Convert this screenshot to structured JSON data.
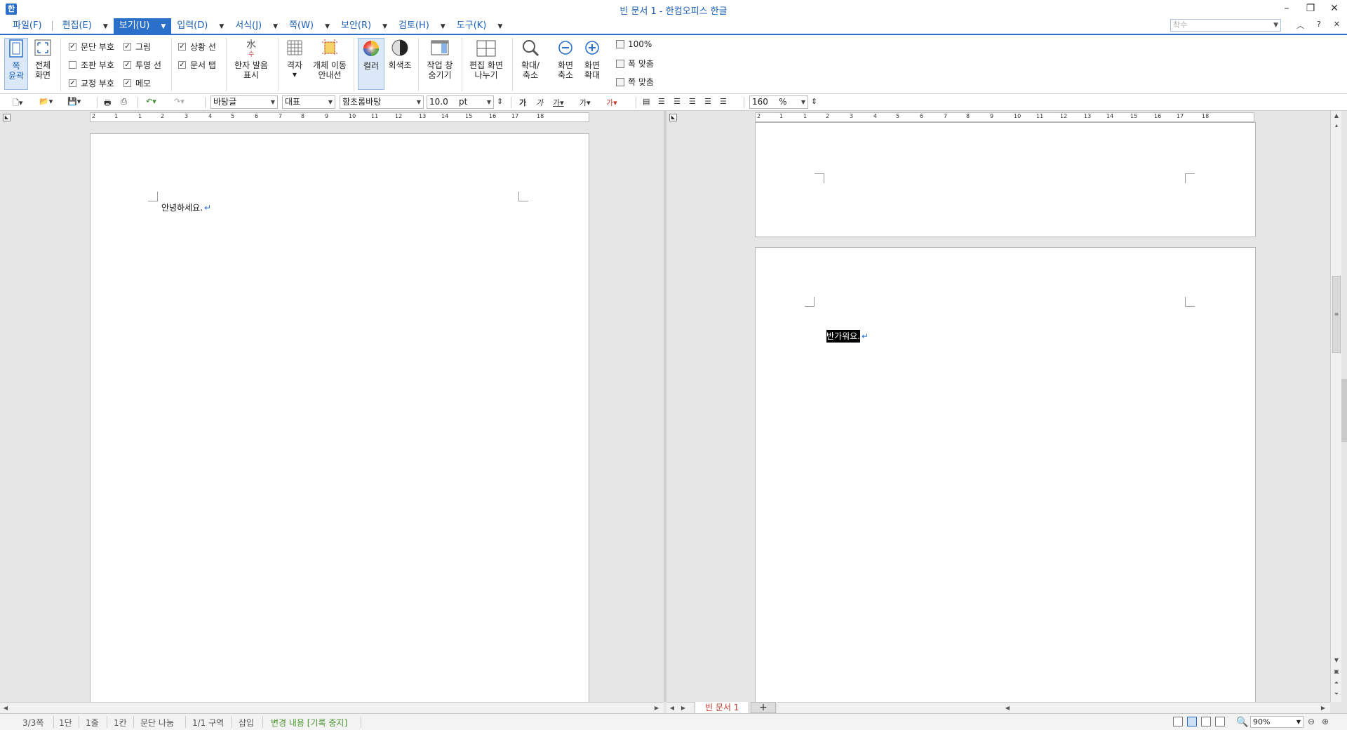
{
  "window": {
    "title": "빈 문서 1 - 한컴오피스 한글",
    "minimize_icon": "minimize-icon",
    "restore_icon": "restore-icon",
    "close_icon": "close-icon"
  },
  "menu": {
    "items": [
      {
        "label": "파일(F)"
      },
      {
        "label": "편집(E)"
      },
      {
        "label": "보기(U)"
      },
      {
        "label": "입력(D)"
      },
      {
        "label": "서식(J)"
      },
      {
        "label": "쪽(W)"
      },
      {
        "label": "보안(R)"
      },
      {
        "label": "검토(H)"
      },
      {
        "label": "도구(K)"
      }
    ],
    "active": "보기(U)",
    "help_search_placeholder": "착수"
  },
  "ribbon": {
    "page_outline": "쪽\n윤곽",
    "full_screen": "전체\n화면",
    "checkboxes": [
      {
        "label": "문단 부호",
        "checked": true
      },
      {
        "label": "그림",
        "checked": true
      },
      {
        "label": "조판 부호",
        "checked": false
      },
      {
        "label": "투명 선",
        "checked": true
      },
      {
        "label": "교정 부호",
        "checked": true
      },
      {
        "label": "메모",
        "checked": true
      },
      {
        "label": "상황 선",
        "checked": true
      },
      {
        "label": "문서 탭",
        "checked": true
      }
    ],
    "hanja_pron": "한자 발음\n표시",
    "grid": "격자",
    "object_move_guide": "개체 이동\n안내선",
    "color": "컬러",
    "grayscale": "회색조",
    "hide_task_pane": "작업 창\n숨기기",
    "split_edit_screen": "편집 화면\n나누기",
    "zoom": "확대/\n축소",
    "zoom_out": "화면\n축소",
    "zoom_in": "화면\n확대",
    "zoom_options": [
      "100%",
      "폭 맞춤",
      "쪽 맞춤"
    ]
  },
  "format_toolbar": {
    "style": "바탕글",
    "language": "대표",
    "font": "함초롬바탕",
    "font_size": "10.0",
    "font_unit": "pt",
    "char_scale": "160",
    "char_scale_unit": "%"
  },
  "left_pane": {
    "text": "안녕하세요."
  },
  "right_pane": {
    "text": "반가워요."
  },
  "tabs": {
    "doc_tab": "빈 문서 1",
    "add": "+"
  },
  "ruler_numbers": [
    "2",
    "1",
    "1",
    "2",
    "3",
    "4",
    "5",
    "6",
    "7",
    "8",
    "9",
    "10",
    "11",
    "12",
    "13",
    "14",
    "15",
    "16",
    "17",
    "18"
  ],
  "status": {
    "page": "3/3쪽",
    "column": "1단",
    "line": "1줄",
    "col": "1칸",
    "para_break": "문단 나눔",
    "section": "1/1 구역",
    "insert": "삽입",
    "track_changes": "변경 내용 [기록 중지]",
    "zoom": "90%"
  }
}
